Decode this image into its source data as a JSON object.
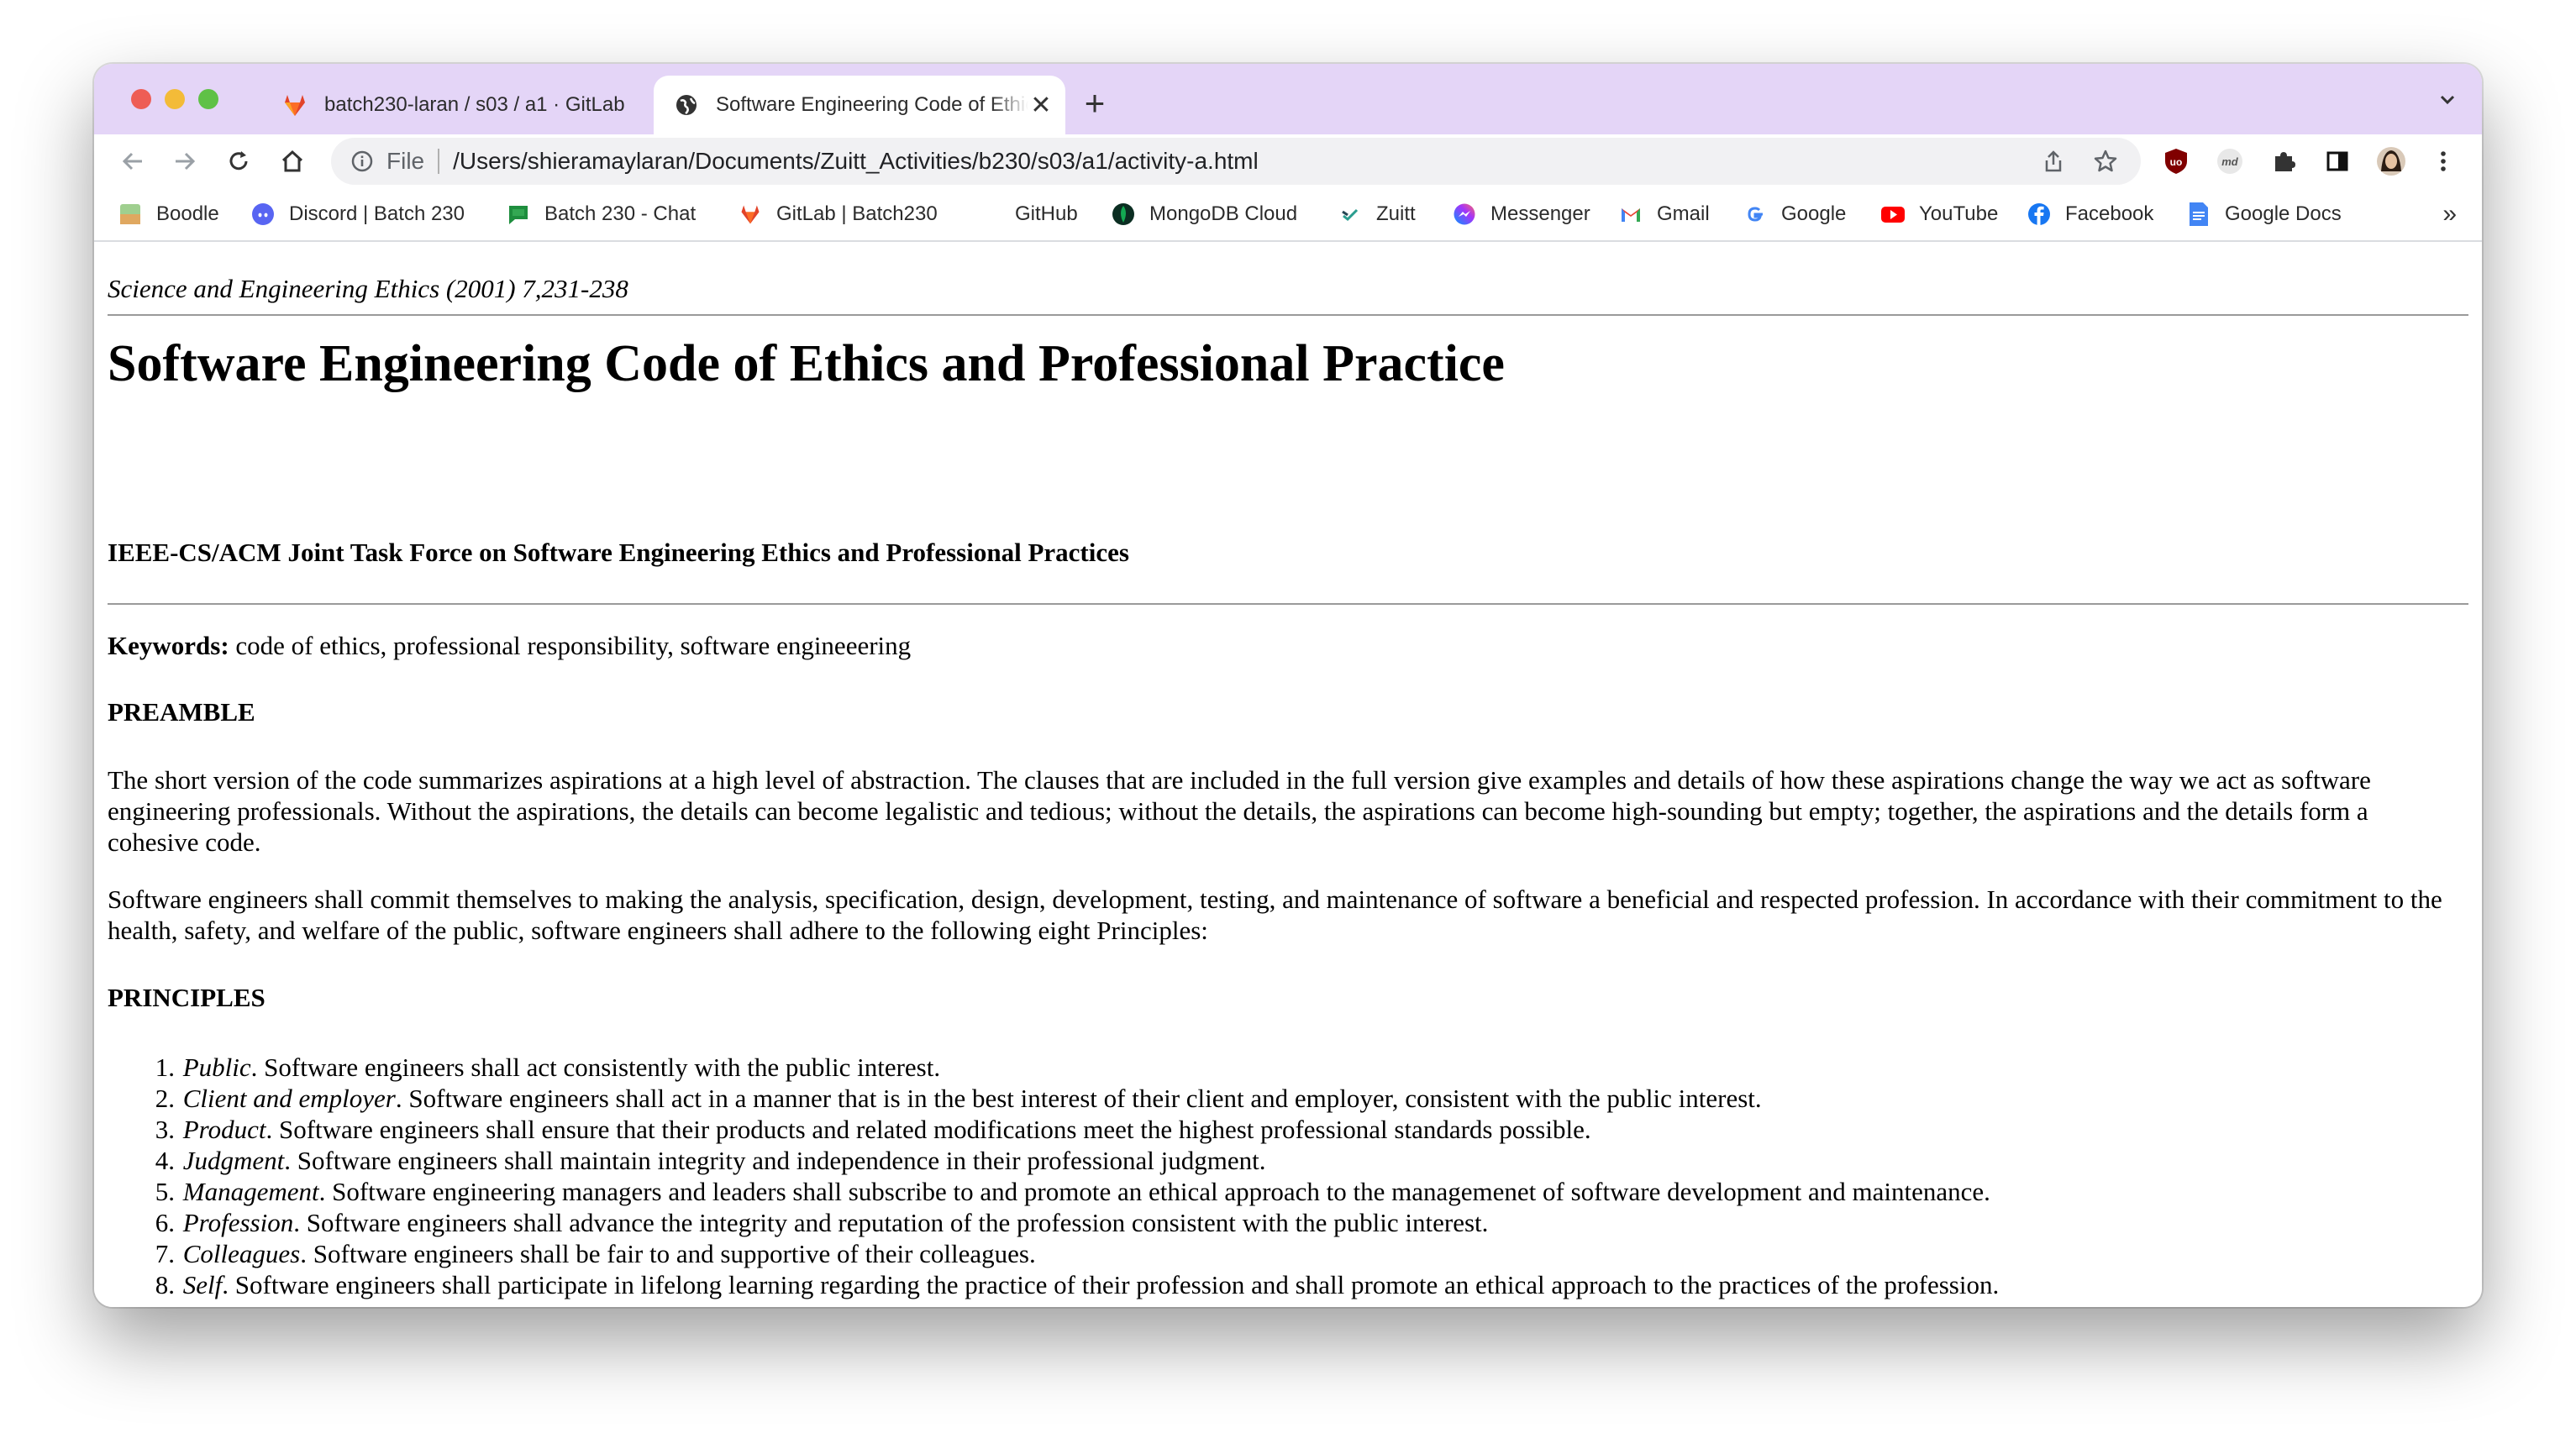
{
  "browser": {
    "tabs": [
      {
        "title": "batch230-laran / s03 / a1 · GitLab",
        "active": false,
        "icon": "gitlab-icon"
      },
      {
        "title": "Software Engineering Code of Ethics",
        "active": true,
        "icon": "globe-icon"
      }
    ],
    "close_glyph": "✕",
    "new_tab_glyph": "+",
    "omnibox": {
      "scheme": "File",
      "url": "/Users/shieramaylaran/Documents/Zuitt_Activities/b230/s03/a1/activity-a.html"
    },
    "bookmarks": [
      {
        "label": "Boodle",
        "icon": "boodle-icon",
        "color": "#7fb77e"
      },
      {
        "label": "Discord | Batch 230",
        "icon": "discord-icon",
        "color": "#5865f2"
      },
      {
        "label": "Batch 230 - Chat",
        "icon": "google-chat-icon",
        "color": "#1e8e3e"
      },
      {
        "label": "GitLab | Batch230",
        "icon": "gitlab-icon",
        "color": "#e24329"
      },
      {
        "label": "GitHub",
        "icon": "github-icon",
        "color": "#ffffff"
      },
      {
        "label": "MongoDB Cloud",
        "icon": "mongodb-icon",
        "color": "#13aa52"
      },
      {
        "label": "Zuitt",
        "icon": "zuitt-icon",
        "color": "#2a9d8f"
      },
      {
        "label": "Messenger",
        "icon": "messenger-icon",
        "color": "#a334fa"
      },
      {
        "label": "Gmail",
        "icon": "gmail-icon",
        "color": "#ea4335"
      },
      {
        "label": "Google",
        "icon": "google-icon",
        "color": "#4285f4"
      },
      {
        "label": "YouTube",
        "icon": "youtube-icon",
        "color": "#ff0000"
      },
      {
        "label": "Facebook",
        "icon": "facebook-icon",
        "color": "#1877f2"
      },
      {
        "label": "Google Docs",
        "icon": "google-docs-icon",
        "color": "#4285f4"
      }
    ],
    "bookmarks_overflow": "»"
  },
  "page": {
    "journal": "Science and Engineering Ethics (2001) 7,231-238",
    "title": "Software Engineering Code of Ethics and Professional Practice",
    "subtitle": "IEEE-CS/ACM Joint Task Force on Software Engineering Ethics and Professional Practices",
    "keywords_label": "Keywords:",
    "keywords": "code of ethics, professional responsibility, software engineeering",
    "preamble_heading": "PREAMBLE",
    "preamble_p1": "The short version of the code summarizes aspirations at a high level of abstraction. The clauses that are included in the full version give examples and details of how these aspirations change the way we act as software engineering professionals. Without the aspirations, the details can become legalistic and tedious; without the details, the aspirations can become high-sounding but empty; together, the aspirations and the details form a cohesive code.",
    "preamble_p2": "Software engineers shall commit themselves to making the analysis, specification, design, development, testing, and maintenance of software a beneficial and respected profession. In accordance with their commitment to the health, safety, and welfare of the public, software engineers shall adhere to the following eight Principles:",
    "principles_heading": "PRINCIPLES",
    "principles": [
      {
        "num": "1.",
        "term": "Public",
        "text": ". Software engineers shall act consistently with the public interest."
      },
      {
        "num": "2.",
        "term": "Client and employer",
        "text": ". Software engineers shall act in a manner that is in the best interest of their client and employer, consistent with the public interest."
      },
      {
        "num": "3.",
        "term": "Product",
        "text": ". Software engineers shall ensure that their products and related modifications meet the highest professional standards possible."
      },
      {
        "num": "4.",
        "term": "Judgment",
        "text": ". Software engineers shall maintain integrity and independence in their professional judgment."
      },
      {
        "num": "5.",
        "term": "Management",
        "text": ". Software engineering managers and leaders shall subscribe to and promote an ethical approach to the managemenet of software development and maintenance."
      },
      {
        "num": "6.",
        "term": "Profession",
        "text": ". Software engineers shall advance the integrity and reputation of the profession consistent with the public interest."
      },
      {
        "num": "7.",
        "term": "Colleagues",
        "text": ". Software engineers shall be fair to and supportive of their colleagues."
      },
      {
        "num": "8.",
        "term": "Self",
        "text": ". Software engineers shall participate in lifelong learning regarding the practice of their profession and shall promote an ethical approach to the practices of the profession."
      }
    ]
  }
}
